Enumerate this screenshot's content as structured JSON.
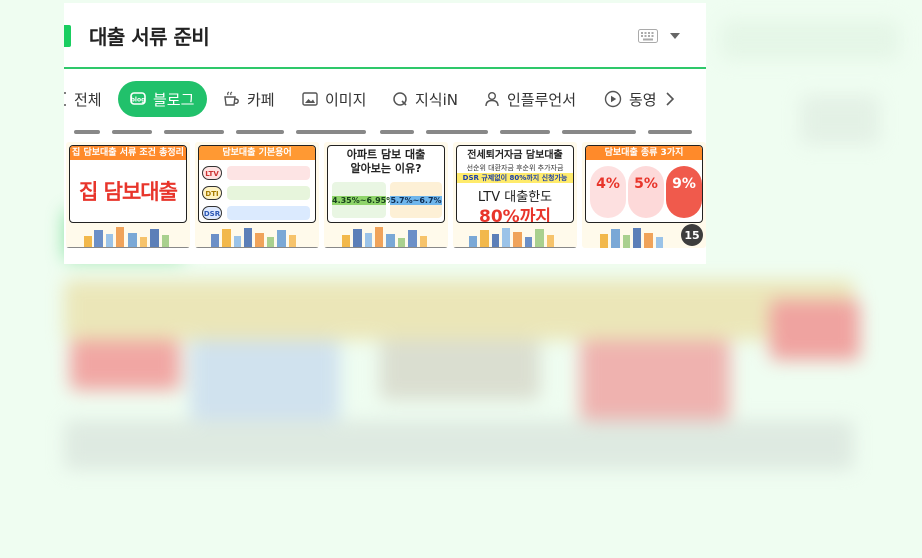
{
  "search": {
    "query": "대출 서류 준비"
  },
  "tabs": [
    {
      "label": "전체",
      "active": false,
      "icon": "all-icon"
    },
    {
      "label": "블로그",
      "active": true,
      "icon": "blog-icon"
    },
    {
      "label": "카페",
      "active": false,
      "icon": "cafe-icon"
    },
    {
      "label": "이미지",
      "active": false,
      "icon": "image-icon"
    },
    {
      "label": "지식iN",
      "active": false,
      "icon": "kin-icon"
    },
    {
      "label": "인플루언서",
      "active": false,
      "icon": "influencer-icon"
    },
    {
      "label": "동영",
      "active": false,
      "icon": "video-icon"
    }
  ],
  "thumbnails": [
    {
      "header": "집 담보대출 서류 조건 총정리",
      "main": "집 담보대출"
    },
    {
      "header": "담보대출 기본용어",
      "tags": [
        "LTV",
        "DTI",
        "DSR"
      ]
    },
    {
      "header": "아파트 담보 대출",
      "sub": "알아보는 이유?",
      "left_rate": "4.35%~6.95%",
      "right_rate": "5.7%~6.7%"
    },
    {
      "header": "전세퇴거자금 담보대출",
      "line1": "선순위 대환자금 후순위 추가자금",
      "line2": "DSR 규제없이 80%까지 신청가능",
      "main1": "LTV 대출한도",
      "main2": "80%까지"
    },
    {
      "header": "담보대출 종류 3가지",
      "rates": [
        "4%",
        "5%",
        "9%"
      ]
    }
  ],
  "more_count": "15",
  "colors": {
    "accent": "#21c16b",
    "search_underline": "#2ec86a",
    "background": "#effdf1"
  }
}
